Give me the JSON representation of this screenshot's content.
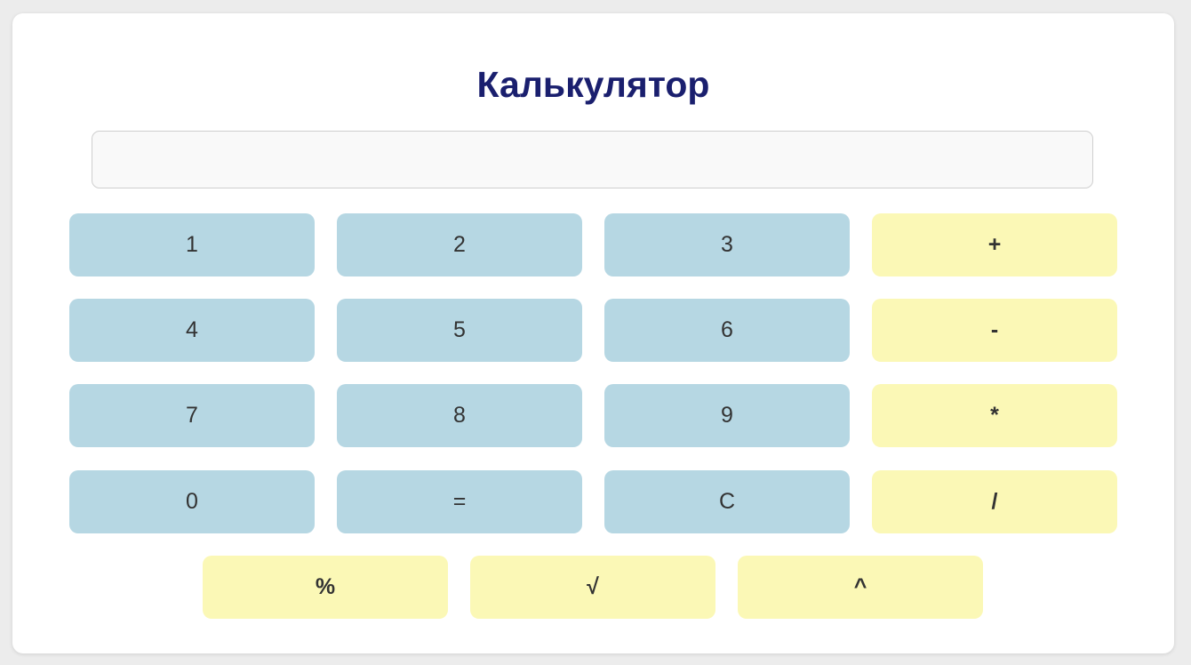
{
  "app": {
    "title": "Калькулятор"
  },
  "display": {
    "value": "",
    "placeholder": ""
  },
  "keys": {
    "one": "1",
    "two": "2",
    "three": "3",
    "plus": "+",
    "four": "4",
    "five": "5",
    "six": "6",
    "minus": "-",
    "seven": "7",
    "eight": "8",
    "nine": "9",
    "multiply": "*",
    "zero": "0",
    "equals": "=",
    "clear": "C",
    "divide": "/",
    "percent": "%",
    "sqrt": "√",
    "power": "^"
  },
  "colors": {
    "title": "#1a1f6e",
    "digit_key": "#b6d7e3",
    "operator_key": "#fbf8b6",
    "card": "#ffffff",
    "page_background": "#ececec"
  }
}
